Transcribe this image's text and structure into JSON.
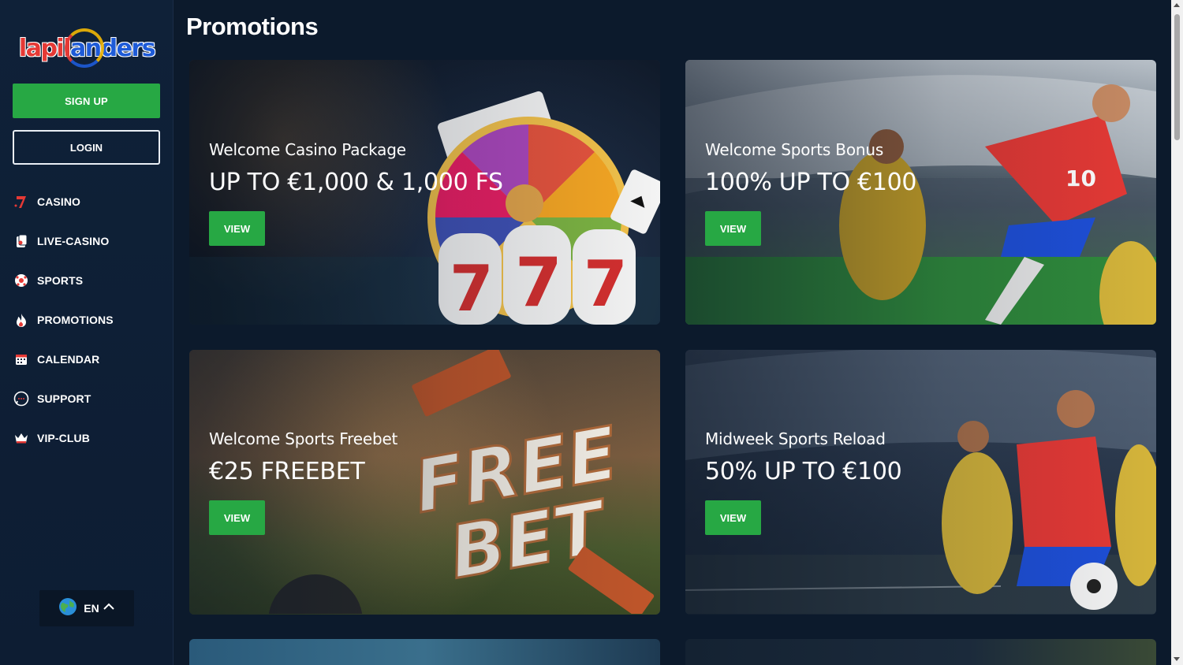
{
  "brand": {
    "logo_text_part1": "lapil",
    "logo_text_part2": "anders",
    "colors": {
      "primary_green": "#27a844",
      "bg_dark": "#0c1a2c",
      "logo_red": "#e53935",
      "logo_blue": "#1e5bd8"
    }
  },
  "sidebar": {
    "signup_label": "SIGN UP",
    "login_label": "LOGIN",
    "items": [
      {
        "label": "CASINO",
        "icon": "seven-icon"
      },
      {
        "label": "LIVE-CASINO",
        "icon": "card-icon"
      },
      {
        "label": "SPORTS",
        "icon": "football-icon"
      },
      {
        "label": "PROMOTIONS",
        "icon": "flame-icon"
      },
      {
        "label": "CALENDAR",
        "icon": "calendar-icon"
      },
      {
        "label": "SUPPORT",
        "icon": "chat-icon"
      },
      {
        "label": "VIP-CLUB",
        "icon": "crown-icon"
      }
    ],
    "language": {
      "label": "EN",
      "icon": "globe-icon"
    }
  },
  "main": {
    "title": "Promotions",
    "cards": [
      {
        "subtitle": "Welcome Casino Package",
        "headline": "UP TO €1,000 & 1,000 FS",
        "button": "VIEW"
      },
      {
        "subtitle": "Welcome Sports Bonus",
        "headline": "100% UP TO €100",
        "button": "VIEW"
      },
      {
        "subtitle": "Welcome Sports Freebet",
        "headline": "€25 FREEBET",
        "button": "VIEW"
      },
      {
        "subtitle": "Midweek Sports Reload",
        "headline": "50% UP TO €100",
        "button": "VIEW"
      }
    ]
  }
}
